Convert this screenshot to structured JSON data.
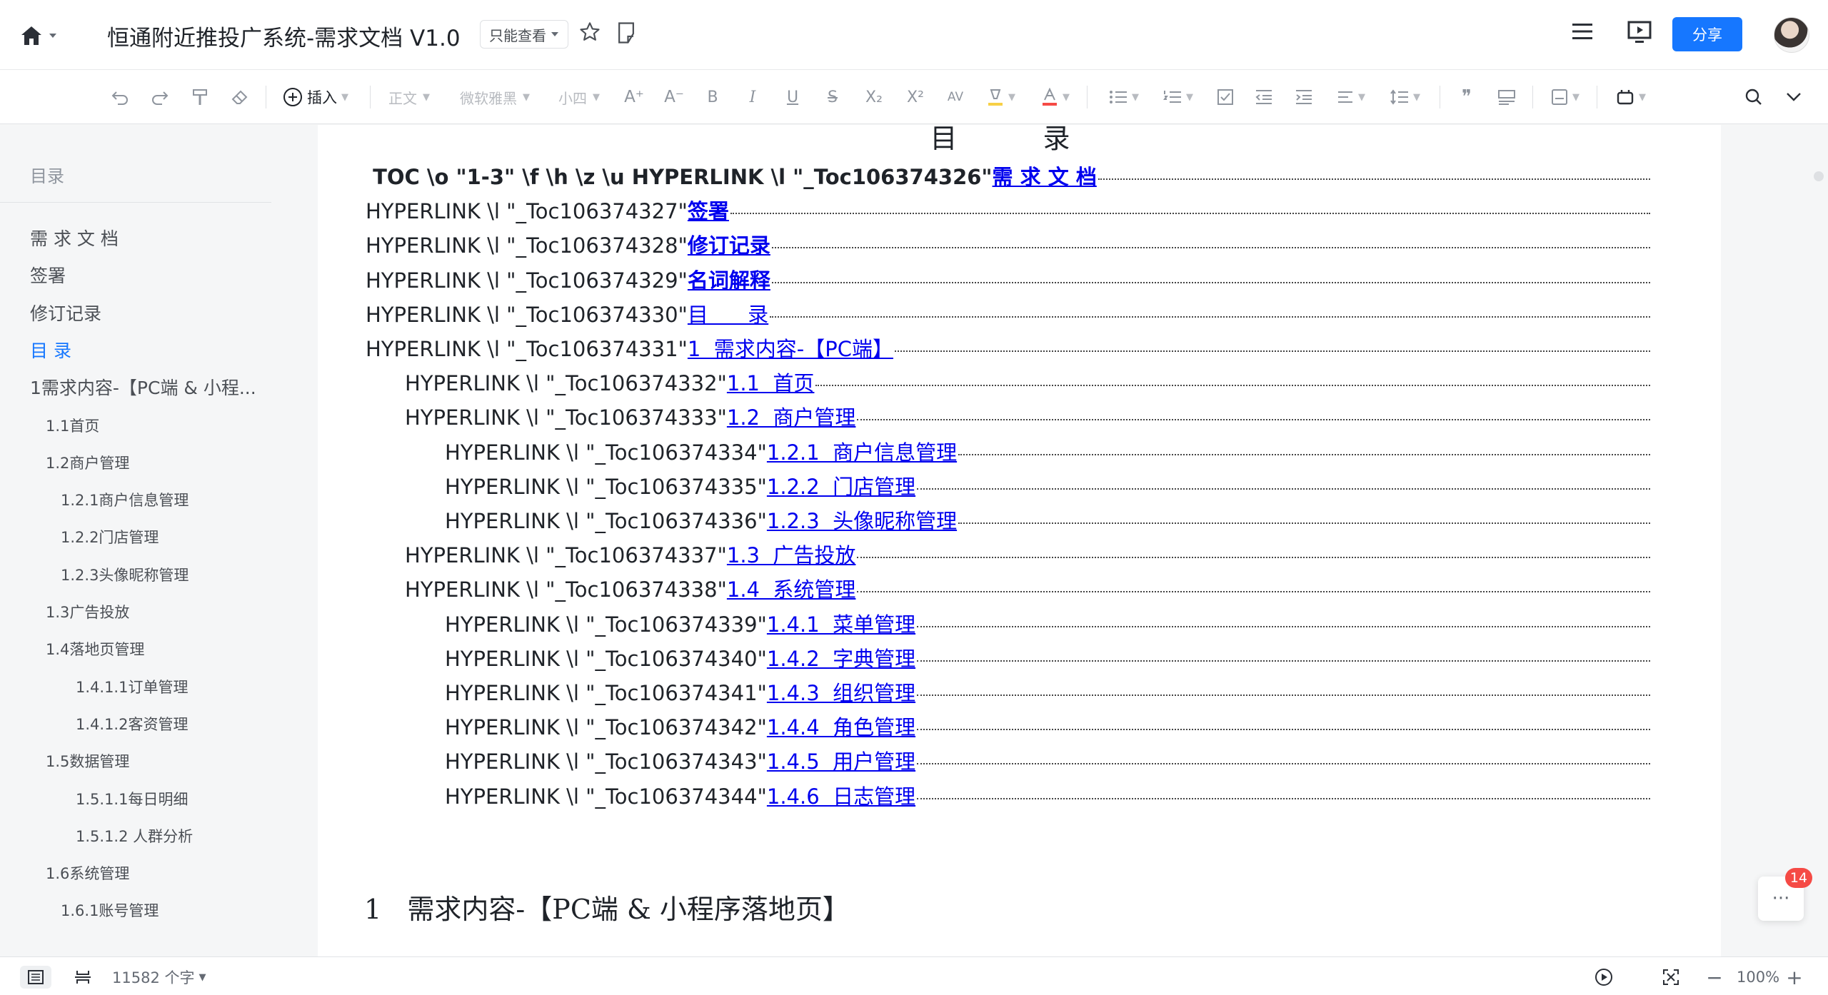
{
  "header": {
    "title": "恒通附近推投广系统-需求文档 V1.0",
    "permission": "只能查看",
    "share_label": "分享"
  },
  "toolbar": {
    "insert_label": "插入",
    "style_label": "正文",
    "font_label": "微软雅黑",
    "size_label": "小四",
    "icons": [
      "undo-icon",
      "redo-icon",
      "format-painter-icon",
      "eraser-icon",
      "insert-icon",
      "font-grow-icon",
      "font-shrink-icon",
      "bold-icon",
      "italic-icon",
      "underline-icon",
      "strikethrough-icon",
      "subscript-icon",
      "superscript-icon",
      "char-spacing-icon",
      "highlight-icon",
      "font-color-icon",
      "bullet-list-icon",
      "numbered-list-icon",
      "checklist-icon",
      "outdent-icon",
      "indent-icon",
      "align-icon",
      "line-spacing-icon",
      "quote-icon",
      "block-icon",
      "page-icon",
      "plugin-icon",
      "search-icon",
      "collapse-icon"
    ]
  },
  "sidebar": {
    "heading": "目录",
    "items": [
      {
        "label": "需 求 文 档",
        "level": 1
      },
      {
        "label": "签署",
        "level": 1
      },
      {
        "label": "修订记录",
        "level": 1
      },
      {
        "label": "目 录",
        "level": 1,
        "active": true
      },
      {
        "label": "1需求内容-【PC端 & 小程...",
        "level": 1
      },
      {
        "label": "1.1首页",
        "level": 2
      },
      {
        "label": "1.2商户管理",
        "level": 2
      },
      {
        "label": "1.2.1商户信息管理",
        "level": 3
      },
      {
        "label": "1.2.2门店管理",
        "level": 3
      },
      {
        "label": "1.2.3头像昵称管理",
        "level": 3
      },
      {
        "label": "1.3广告投放",
        "level": 2
      },
      {
        "label": "1.4落地页管理",
        "level": 2
      },
      {
        "label": "1.4.1.1订单管理",
        "level": 4
      },
      {
        "label": "1.4.1.2客资管理",
        "level": 4
      },
      {
        "label": "1.5数据管理",
        "level": 2
      },
      {
        "label": "1.5.1.1每日明细",
        "level": 4
      },
      {
        "label": "1.5.1.2 人群分析",
        "level": 4
      },
      {
        "label": "1.6系统管理",
        "level": 2
      },
      {
        "label": "1.6.1账号管理",
        "level": 3
      }
    ]
  },
  "document": {
    "title": "目 录",
    "toc_lines": [
      {
        "code": " TOC \\o \"1-3\" \\f \\h \\z \\u HYPERLINK \\l \"_Toc106374326\"",
        "link": "需 求 文 档",
        "bold": true,
        "indent": 0
      },
      {
        "code": "HYPERLINK \\l \"_Toc106374327\"",
        "link": "签署",
        "bold": true,
        "indent": 0
      },
      {
        "code": "HYPERLINK \\l \"_Toc106374328\"",
        "link": "修订记录",
        "bold": true,
        "indent": 0
      },
      {
        "code": "HYPERLINK \\l \"_Toc106374329\"",
        "link": "名词解释",
        "bold": true,
        "indent": 0
      },
      {
        "code": "HYPERLINK \\l \"_Toc106374330\"",
        "link": "目      录",
        "bold": false,
        "indent": 0
      },
      {
        "code": "HYPERLINK \\l \"_Toc106374331\"",
        "link": "1  需求内容-【PC端】",
        "bold": false,
        "indent": 0
      },
      {
        "code": "HYPERLINK \\l \"_Toc106374332\"",
        "link": "1.1  首页",
        "bold": false,
        "indent": 1
      },
      {
        "code": "HYPERLINK \\l \"_Toc106374333\"",
        "link": "1.2  商户管理",
        "bold": false,
        "indent": 1
      },
      {
        "code": "HYPERLINK \\l \"_Toc106374334\"",
        "link": "1.2.1  商户信息管理",
        "bold": false,
        "indent": 2
      },
      {
        "code": "HYPERLINK \\l \"_Toc106374335\"",
        "link": "1.2.2  门店管理",
        "bold": false,
        "indent": 2
      },
      {
        "code": "HYPERLINK \\l \"_Toc106374336\"",
        "link": "1.2.3  头像昵称管理",
        "bold": false,
        "indent": 2
      },
      {
        "code": "HYPERLINK \\l \"_Toc106374337\"",
        "link": "1.3  广告投放",
        "bold": false,
        "indent": 1
      },
      {
        "code": "HYPERLINK \\l \"_Toc106374338\"",
        "link": "1.4  系统管理",
        "bold": false,
        "indent": 1
      },
      {
        "code": "HYPERLINK \\l \"_Toc106374339\"",
        "link": "1.4.1  菜单管理",
        "bold": false,
        "indent": 2
      },
      {
        "code": "HYPERLINK \\l \"_Toc106374340\"",
        "link": "1.4.2  字典管理",
        "bold": false,
        "indent": 2
      },
      {
        "code": "HYPERLINK \\l \"_Toc106374341\"",
        "link": "1.4.3  组织管理",
        "bold": false,
        "indent": 2
      },
      {
        "code": "HYPERLINK \\l \"_Toc106374342\"",
        "link": "1.4.4  角色管理",
        "bold": false,
        "indent": 2
      },
      {
        "code": "HYPERLINK \\l \"_Toc106374343\"",
        "link": "1.4.5  用户管理",
        "bold": false,
        "indent": 2
      },
      {
        "code": "HYPERLINK \\l \"_Toc106374344\"",
        "link": "1.4.6  日志管理",
        "bold": false,
        "indent": 2
      }
    ],
    "heading1": "1   需求内容-【PC端 & 小程序落地页】"
  },
  "comments": {
    "more_label": "···",
    "badge": "14"
  },
  "statusbar": {
    "word_count": "11582 个字",
    "zoom": "100%",
    "zoom_out": "−",
    "zoom_in": "+"
  }
}
